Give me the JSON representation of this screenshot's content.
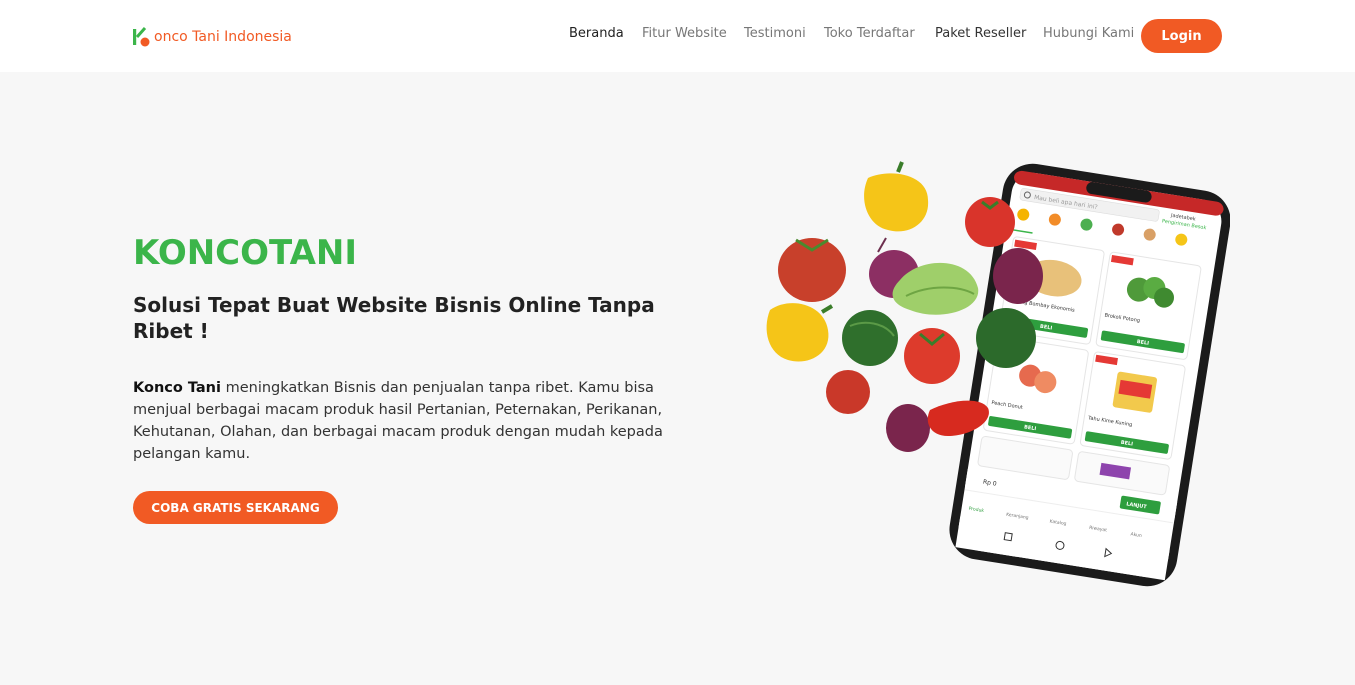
{
  "brand": {
    "name": "onco Tani Indonesia",
    "colors": {
      "primary": "#f15a24",
      "green": "#3bb54a"
    }
  },
  "nav": {
    "items": [
      {
        "label": "Beranda"
      },
      {
        "label": "Fitur Website"
      },
      {
        "label": "Testimoni"
      },
      {
        "label": "Toko Terdaftar"
      },
      {
        "label": "Paket Reseller"
      },
      {
        "label": "Hubungi Kami"
      }
    ],
    "login_label": "Login"
  },
  "hero": {
    "title": "KONCOTANI",
    "subtitle": "Solusi Tepat Buat Website Bisnis Online Tanpa Ribet !",
    "desc_bold": "Konco Tani",
    "desc_rest": " meningkatkan Bisnis dan penjualan tanpa ribet. Kamu bisa menjual berbagai macam produk hasil Pertanian, Peternakan, Perikanan, Kehutanan, Olahan, dan berbagai macam produk dengan mudah kepada pelangan kamu.",
    "cta_label": "COBA GRATIS SEKARANG"
  },
  "phone": {
    "search_placeholder": "Mau beli apa hari ini?",
    "location": "Jadetabek",
    "delivery": "Pengiriman Besok",
    "categories": [
      "Semua Produk",
      "Buah",
      "Sayuran",
      "Daging",
      "Makanan Siap Saji",
      "Bahan Pokok"
    ],
    "products": [
      {
        "name": "Bawang Bombay Ekonomis",
        "button": "BELI"
      },
      {
        "name": "Brokoli Potong",
        "button": "BELI"
      },
      {
        "name": "Peach Donut",
        "button": "BELI"
      },
      {
        "name": "Tahu Kime Kuning",
        "button": "BELI"
      }
    ],
    "price_total": "Rp 0",
    "continue": "LANJUT",
    "tabs": [
      "Produk",
      "Keranjang",
      "Katalog",
      "Riwayat",
      "Akun"
    ],
    "flash_sale": "FLASH SALE"
  }
}
